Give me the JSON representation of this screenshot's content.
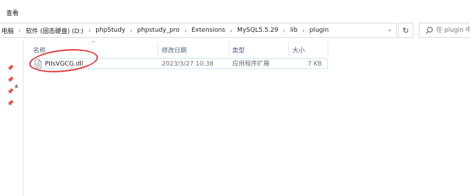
{
  "ribbon": {
    "view_tab": "查看"
  },
  "address": {
    "crumbs": [
      "电脑",
      "软件 (固态硬盘) (D:)",
      "phpStudy",
      "phpstudy_pro",
      "Extensions",
      "MySQL5.5.29",
      "lib",
      "plugin"
    ],
    "separator": "›",
    "dropdown_glyph": "⌄",
    "refresh_glyph": "↻"
  },
  "search": {
    "placeholder": "在 plugin 中"
  },
  "columns": {
    "name": "名称",
    "modified": "修改日期",
    "type": "类型",
    "size": "大小"
  },
  "files": [
    {
      "name": "PIIsVGCG.dll",
      "modified": "2023/3/27 10:38",
      "type": "应用程序扩展",
      "size": "7 KB"
    }
  ],
  "icons": {
    "pin": "pin-icon",
    "file": "dll-file-icon",
    "search": "search-icon"
  },
  "colors": {
    "annotation": "#e0393b",
    "selection_border": "#cce8ff",
    "header_text": "#4c607a"
  }
}
